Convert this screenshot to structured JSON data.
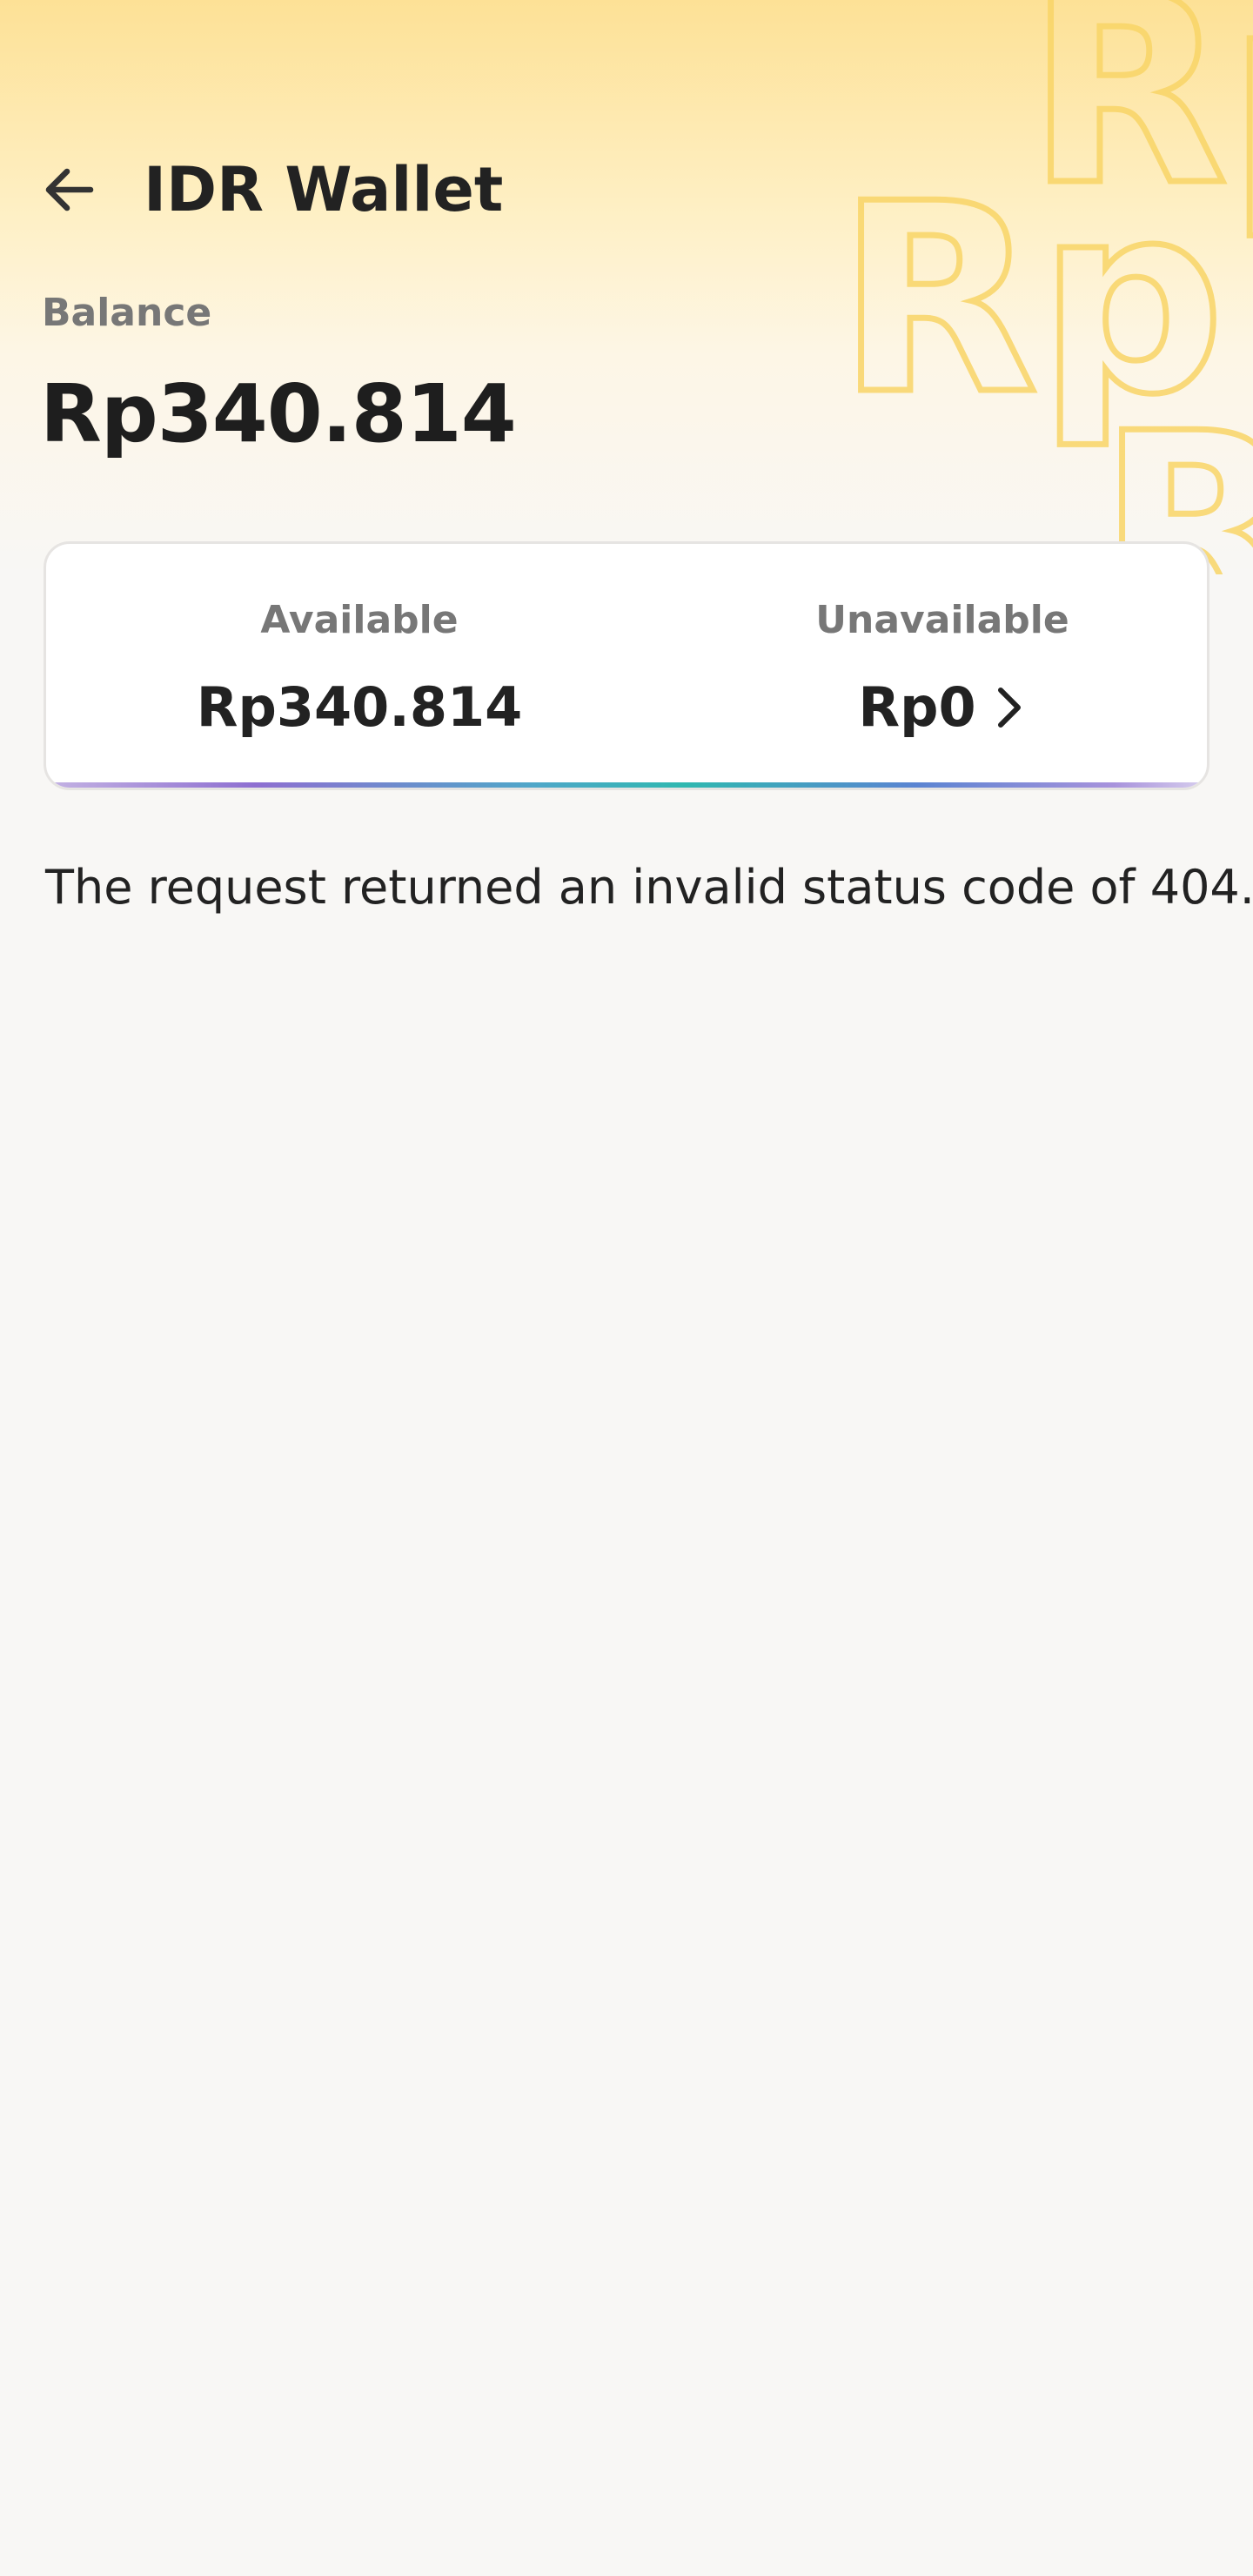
{
  "header": {
    "title": "IDR Wallet",
    "back_icon": "arrow-left-icon"
  },
  "balance": {
    "label": "Balance",
    "value": "Rp340.814"
  },
  "summary": {
    "available": {
      "label": "Available",
      "value": "Rp340.814"
    },
    "unavailable": {
      "label": "Unavailable",
      "value": "Rp0",
      "icon": "chevron-right-icon"
    }
  },
  "error": {
    "message": "The request returned an invalid status code of 404."
  },
  "colors": {
    "hero_top": "#fde196",
    "watermark_stroke": "#f9d567",
    "background": "#f8f7f5",
    "text_primary": "#222222",
    "text_secondary": "#777777"
  },
  "watermark": {
    "text": "Rp"
  }
}
